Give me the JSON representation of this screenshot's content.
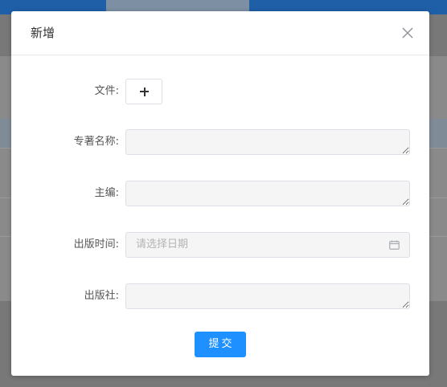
{
  "dialog": {
    "title": "新增",
    "close_icon": "close-icon"
  },
  "form": {
    "file_label": "文件:",
    "upload_icon": "plus-icon",
    "name_label": "专著名称:",
    "name_value": "",
    "editor_label": "主编:",
    "editor_value": "",
    "date_label": "出版时间:",
    "date_placeholder": "请选择日期",
    "date_icon": "calendar-icon",
    "publisher_label": "出版社:",
    "publisher_value": ""
  },
  "actions": {
    "submit_label": "提交"
  },
  "colors": {
    "primary": "#1e90ff",
    "input_bg": "#f5f5f5",
    "overlay": "#787878"
  }
}
